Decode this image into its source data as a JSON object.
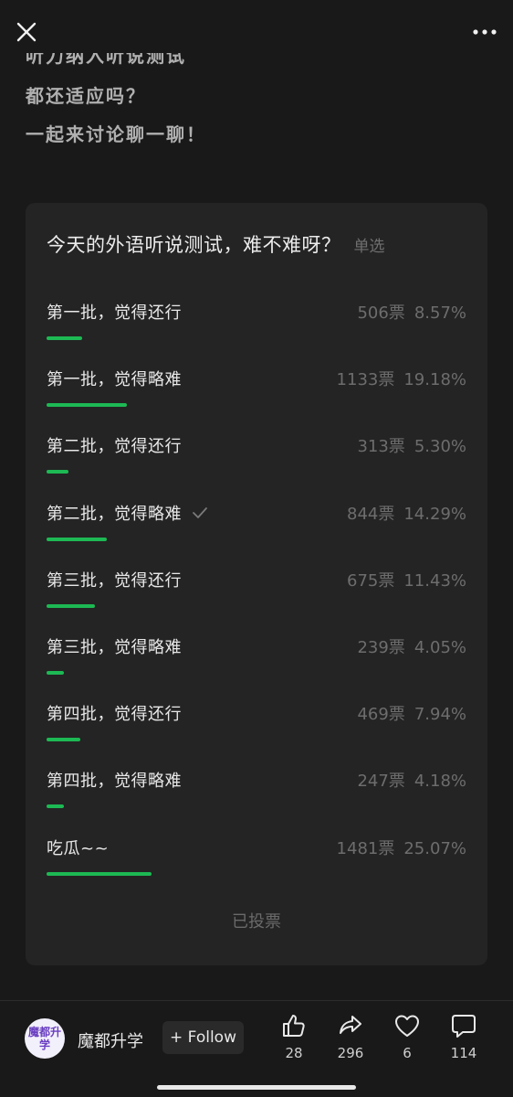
{
  "article": {
    "lines": [
      "听力纳入听说测试",
      "都还适应吗？",
      "一起来讨论聊一聊！"
    ]
  },
  "poll": {
    "title": "今天的外语听说测试，难不难呀？",
    "type": "单选",
    "voted_label": "已投票",
    "options": [
      {
        "label": "第一批，觉得还行",
        "votes": "506票",
        "percent": "8.57%",
        "fraction": 0.0857,
        "selected": false
      },
      {
        "label": "第一批，觉得略难",
        "votes": "1133票",
        "percent": "19.18%",
        "fraction": 0.1918,
        "selected": false
      },
      {
        "label": "第二批，觉得还行",
        "votes": "313票",
        "percent": "5.30%",
        "fraction": 0.053,
        "selected": false
      },
      {
        "label": "第二批，觉得略难",
        "votes": "844票",
        "percent": "14.29%",
        "fraction": 0.1429,
        "selected": true
      },
      {
        "label": "第三批，觉得还行",
        "votes": "675票",
        "percent": "11.43%",
        "fraction": 0.1143,
        "selected": false
      },
      {
        "label": "第三批，觉得略难",
        "votes": "239票",
        "percent": "4.05%",
        "fraction": 0.0405,
        "selected": false
      },
      {
        "label": "第四批，觉得还行",
        "votes": "469票",
        "percent": "7.94%",
        "fraction": 0.0794,
        "selected": false
      },
      {
        "label": "第四批，觉得略难",
        "votes": "247票",
        "percent": "4.18%",
        "fraction": 0.0418,
        "selected": false
      },
      {
        "label": "吃瓜~~",
        "votes": "1481票",
        "percent": "25.07%",
        "fraction": 0.2507,
        "selected": false
      }
    ],
    "check_icon": "checkmark-icon"
  },
  "author": {
    "avatar_text": "魔都升学",
    "name": "魔都升学",
    "follow_label": "+ Follow"
  },
  "actions": {
    "like": {
      "icon": "thumbs-up-icon",
      "count": "28"
    },
    "share": {
      "icon": "share-arrow-icon",
      "count": "296"
    },
    "favorite": {
      "icon": "heart-icon",
      "count": "6"
    },
    "comment": {
      "icon": "comment-bubble-icon",
      "count": "114"
    }
  },
  "colors": {
    "background": "#191919",
    "card": "#242424",
    "accent_bar": "#1db954"
  }
}
